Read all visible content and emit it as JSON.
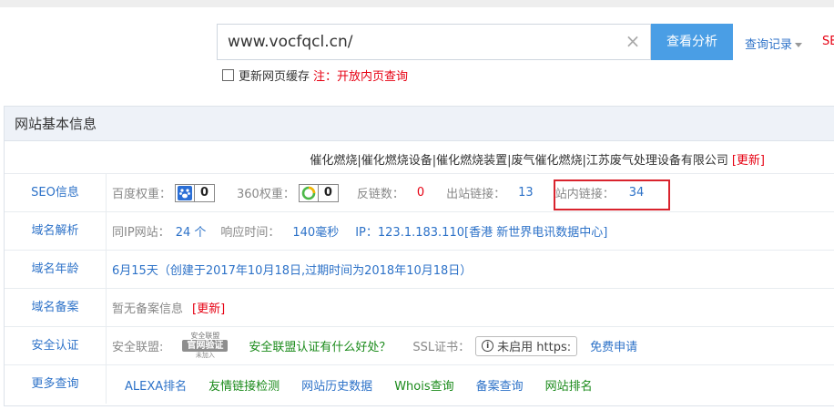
{
  "search": {
    "value": "www.vocfqcl.cn/",
    "clear_icon": "close-icon",
    "button_label": "查看分析",
    "history_label": "查询记录",
    "seo_label": "SEO"
  },
  "cache": {
    "label": "更新网页缓存",
    "note": "注：开放内页查询"
  },
  "panel": {
    "title": "网站基本信息",
    "company": "催化燃烧|催化燃烧设备|催化燃烧装置|废气催化燃烧|江苏废气处理设备有限公司",
    "company_update": "[更新]"
  },
  "seo": {
    "label": "SEO信息",
    "baidu_label": "百度权重：",
    "baidu_value": "0",
    "w360_label": "360权重：",
    "w360_value": "0",
    "backlinks_label": "反链数：",
    "backlinks_value": "0",
    "outlinks_label": "出站链接：",
    "outlinks_value": "13",
    "inlinks_label": "站内链接：",
    "inlinks_value": "34"
  },
  "dns": {
    "label": "域名解析",
    "same_ip_label": "同IP网站：",
    "same_ip_value": "24 个",
    "response_label": "响应时间：",
    "response_value": "140毫秒",
    "ip_text": "IP：123.1.183.110[香港 新世界电讯数据中心]"
  },
  "age": {
    "label": "域名年龄",
    "text": "6月15天（创建于2017年10月18日,过期时间为2018年10月18日）"
  },
  "icp": {
    "label": "域名备案",
    "text": "暂无备案信息",
    "update": "[更新]"
  },
  "cert": {
    "label": "安全认证",
    "alliance_label": "安全联盟:",
    "seal_top": "安全联盟",
    "seal_mid": "官网验证",
    "seal_bot": "未加入",
    "alliance_link": "安全联盟认证有什么好处？",
    "ssl_label": "SSL证书：",
    "ssl_status": "未启用 https:",
    "ssl_apply": "免费申请"
  },
  "more": {
    "label": "更多查询",
    "links": [
      "ALEXA排名",
      "友情链接检测",
      "网站历史数据",
      "Whois查询",
      "备案查询",
      "网站排名"
    ]
  },
  "colors": {
    "accent_blue": "#4a9ee5",
    "link_blue": "#2d72c8",
    "alert_red": "#e60012",
    "link_green": "#1a8a1a"
  }
}
